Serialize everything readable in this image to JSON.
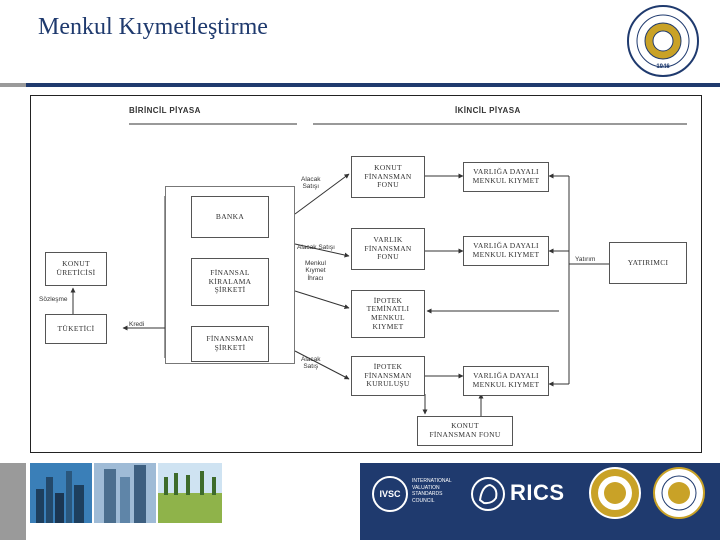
{
  "header": {
    "title": "Menkul Kıymetleştirme",
    "logo_text": "ANKARA ÜNİVERSİTESİ",
    "logo_year": "1946"
  },
  "diagram": {
    "sections": {
      "primary": "BİRİNCİL PİYASA",
      "secondary": "İKİNCİL PİYASA"
    },
    "nodes": {
      "konut_uretici": "KONUT\nÜRETİCİSİ",
      "tuketici": "TÜKETİCİ",
      "banka": "BANKA",
      "finansal_kiralama": "FİNANSAL\nKİRALAMA\nŞİRKETİ",
      "finansman_sirketi": "FİNANSMAN\nŞİRKETİ",
      "konut_finansman_fonu_top": "KONUT\nFİNANSMAN\nFONU",
      "varlik_finansman_fonu": "VARLIK\nFİNANSMAN\nFONU",
      "ipotek_teminatli": "İPOTEK\nTEMİNATLI\nMENKUL\nKIYMET",
      "ipotek_finansman_kurulusu": "İPOTEK\nFİNANSMAN\nKURULUŞU",
      "vdmk_1": "VARLIĞA DAYALI\nMENKUL KIYMET",
      "vdmk_2": "VARLIĞA DAYALI\nMENKUL KIYMET",
      "vdmk_3": "VARLIĞA DAYALI\nMENKUL KIYMET",
      "yatirimci": "YATIRIMCI",
      "konut_finansman_fonu_bottom": "KONUT\nFİNANSMAN FONU"
    },
    "edge_labels": {
      "alacak_satisi_top": "Alacak\nSatışı",
      "alacak_satisi_mid": "Alacak Satışı",
      "menkul_kiymet_ihraci": "Menkul\nKıymet\nİhracı",
      "alacak_satisi_bottom": "Alacak\nSatış",
      "sozlesme": "Sözleşme",
      "kredi": "Kredi",
      "yatirim": "Yatırım"
    }
  },
  "footer": {
    "ivsc_mark": "IVSC",
    "ivsc_name": "INTERNATIONAL\nVALUATION\nSTANDARDS\nCOUNCIL",
    "rics": "RICS"
  },
  "colors": {
    "brand_navy": "#1f3a6e",
    "accent_grey": "#9a9a9a",
    "gold": "#c9a227"
  }
}
